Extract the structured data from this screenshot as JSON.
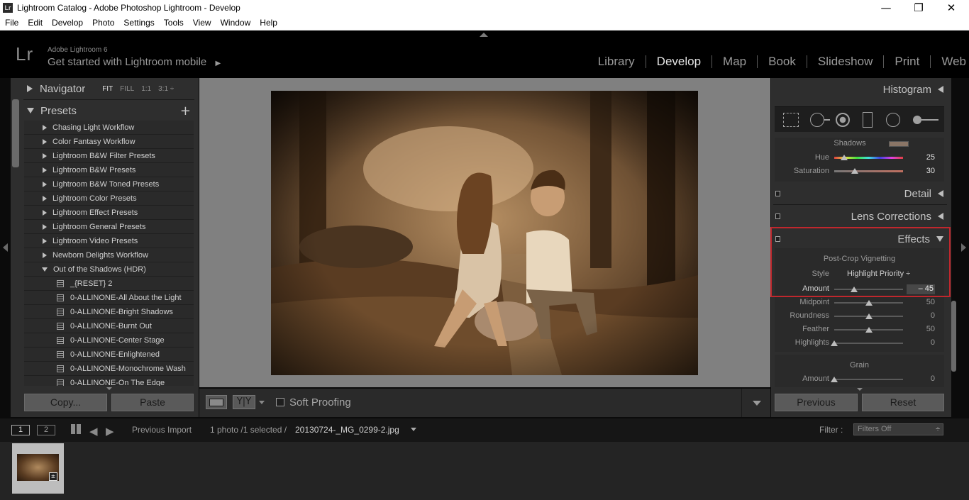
{
  "window": {
    "title": "Lightroom Catalog - Adobe Photoshop Lightroom - Develop",
    "app_icon": "Lr",
    "controls": {
      "minimize": "—",
      "restore": "❐",
      "close": "✕"
    }
  },
  "menu": [
    "File",
    "Edit",
    "Develop",
    "Photo",
    "Settings",
    "Tools",
    "View",
    "Window",
    "Help"
  ],
  "identity": {
    "logo": "Lr",
    "product": "Adobe Lightroom 6",
    "mobile_prompt": "Get started with Lightroom mobile",
    "arrow": "▶"
  },
  "modules": [
    {
      "label": "Library",
      "active": false
    },
    {
      "label": "Develop",
      "active": true
    },
    {
      "label": "Map",
      "active": false
    },
    {
      "label": "Book",
      "active": false
    },
    {
      "label": "Slideshow",
      "active": false
    },
    {
      "label": "Print",
      "active": false
    },
    {
      "label": "Web",
      "active": false
    }
  ],
  "navigator": {
    "title": "Navigator",
    "options": [
      "FIT",
      "FILL",
      "1:1",
      "3:1 ÷"
    ],
    "selected": "FIT"
  },
  "presets": {
    "title": "Presets",
    "add": "+",
    "folders": [
      "Chasing Light Workflow",
      "Color Fantasy Workflow",
      "Lightroom B&W Filter Presets",
      "Lightroom B&W Presets",
      "Lightroom B&W Toned Presets",
      "Lightroom Color Presets",
      "Lightroom Effect Presets",
      "Lightroom General Presets",
      "Lightroom Video Presets",
      "Newborn Delights Workflow"
    ],
    "open_folder": "Out of the Shadows (HDR)",
    "items": [
      "_{RESET} 2",
      "0-ALLINONE-All About the Light",
      "0-ALLINONE-Bright Shadows",
      "0-ALLINONE-Burnt Out",
      "0-ALLINONE-Center Stage",
      "0-ALLINONE-Enlightened",
      "0-ALLINONE-Monochrome Wash",
      "0-ALLINONE-On The Edge"
    ]
  },
  "left_buttons": {
    "copy": "Copy...",
    "paste": "Paste"
  },
  "toolbar": {
    "soft_proofing": "Soft Proofing",
    "yy": "Y|Y"
  },
  "histogram": {
    "title": "Histogram"
  },
  "split_toning": {
    "section": "Shadows",
    "shadow_swatch": "#8a7566",
    "hue": {
      "label": "Hue",
      "value": "25",
      "level": 0.14
    },
    "saturation": {
      "label": "Saturation",
      "value": "30",
      "level": 0.3
    }
  },
  "panels": {
    "detail": "Detail",
    "lens": "Lens Corrections",
    "effects": "Effects"
  },
  "effects": {
    "section": "Post-Crop Vignetting",
    "style_label": "Style",
    "style_value": "Highlight Priority ÷",
    "sliders": [
      {
        "label": "Amount",
        "value": "– 45",
        "level": 0.29,
        "highlight": true
      },
      {
        "label": "Midpoint",
        "value": "50",
        "level": 0.5,
        "highlight": false
      },
      {
        "label": "Roundness",
        "value": "0",
        "level": 0.5,
        "highlight": false
      },
      {
        "label": "Feather",
        "value": "50",
        "level": 0.5,
        "highlight": false
      },
      {
        "label": "Highlights",
        "value": "0",
        "level": 0.0,
        "highlight": false
      }
    ],
    "grain_section": "Grain",
    "grain_amount": {
      "label": "Amount",
      "value": "0",
      "level": 0.0
    }
  },
  "right_buttons": {
    "previous": "Previous",
    "reset": "Reset"
  },
  "filmstrip": {
    "screen1": "1",
    "screen2": "2",
    "source": "Previous Import",
    "count": "1 photo /1 selected /",
    "filename": "20130724-_MG_0299-2.jpg",
    "filter_label": "Filter :",
    "filter_value": "Filters Off"
  },
  "colors": {
    "highlight_box": "#c0272d",
    "background": "#0b0b0b",
    "panel": "#2e2e2e"
  }
}
